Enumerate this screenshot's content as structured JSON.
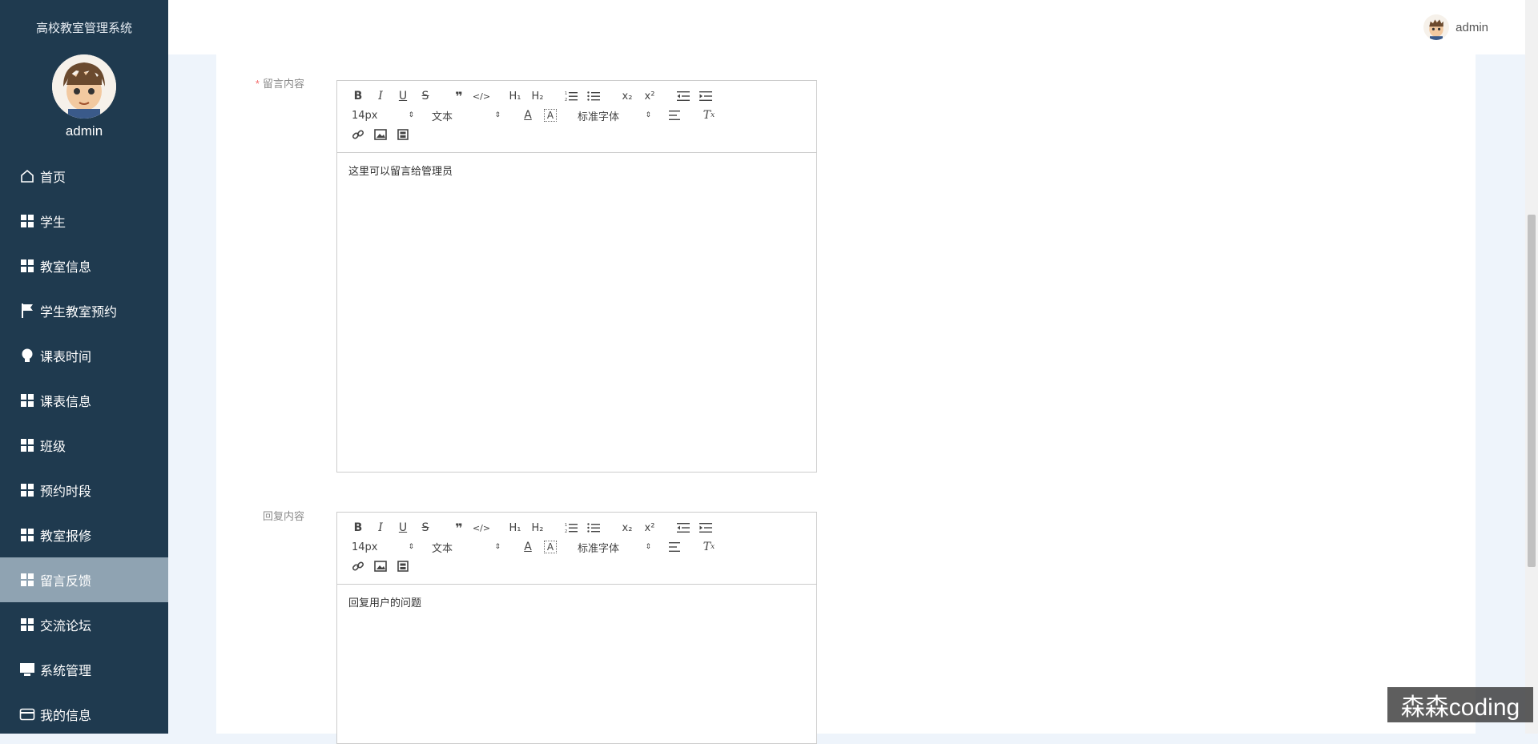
{
  "app": {
    "system_title": "高校教室管理系统",
    "username": "admin"
  },
  "header": {
    "username": "admin"
  },
  "sidebar": {
    "items": [
      {
        "label": "首页",
        "icon": "home-icon"
      },
      {
        "label": "学生",
        "icon": "grid-icon"
      },
      {
        "label": "教室信息",
        "icon": "grid-icon"
      },
      {
        "label": "学生教室预约",
        "icon": "flag-icon"
      },
      {
        "label": "课表时间",
        "icon": "bulb-icon"
      },
      {
        "label": "课表信息",
        "icon": "grid-icon"
      },
      {
        "label": "班级",
        "icon": "grid-icon"
      },
      {
        "label": "预约时段",
        "icon": "grid-icon"
      },
      {
        "label": "教室报修",
        "icon": "grid-icon"
      },
      {
        "label": "留言反馈",
        "icon": "grid-icon",
        "active": true
      },
      {
        "label": "交流论坛",
        "icon": "grid-icon"
      },
      {
        "label": "系统管理",
        "icon": "monitor-icon"
      },
      {
        "label": "我的信息",
        "icon": "card-icon"
      }
    ]
  },
  "form": {
    "message": {
      "required_mark": "*",
      "label": "留言内容",
      "content": "这里可以留言给管理员"
    },
    "reply": {
      "label": "回复内容",
      "content": "回复用户的问题"
    }
  },
  "editor_toolbar": {
    "font_size": "14px",
    "header_select": "文本",
    "font_family": "标准字体"
  },
  "watermark": "森森coding",
  "colors": {
    "sidebar_bg": "#1f3a4f",
    "active_item_bg": "#8fa3b2",
    "required": "#f56c6c"
  }
}
